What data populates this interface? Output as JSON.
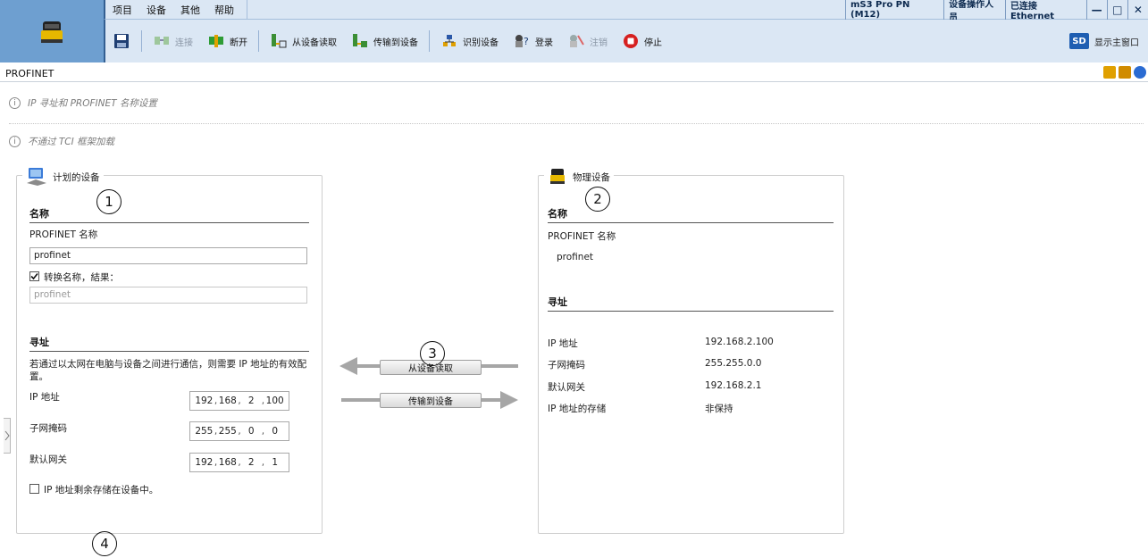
{
  "menu": {
    "items": [
      "项目",
      "设备",
      "其他",
      "帮助"
    ]
  },
  "status": {
    "device": "mS3 Pro PN (M12)",
    "user": "设备操作人员",
    "connection": "已连接 Ethernet"
  },
  "window_buttons": {
    "minimize": "—",
    "maximize": "□",
    "close": "✕"
  },
  "toolbar": {
    "connect": "连接",
    "disconnect": "断开",
    "read_from_device": "从设备读取",
    "transfer_to_device": "传输到设备",
    "identify_device": "识别设备",
    "login": "登录",
    "logout": "注销",
    "stop": "停止",
    "show_main": "显示主窗口",
    "show_main_badge": "SD"
  },
  "page": {
    "title": "PROFINET",
    "info1": "IP 寻址和 PROFINET 名称设置",
    "info2": "不通过 TCI 框架加载",
    "info_icon": "i"
  },
  "planned": {
    "legend": "计划的设备",
    "name_head": "名称",
    "profinet_label": "PROFINET 名称",
    "profinet_value": "profinet",
    "convert_label": "转换名称，結果：",
    "convert_checked": true,
    "convert_result": "profinet",
    "addr_head": "寻址",
    "addr_desc": "若通过以太网在电脑与设备之间进行通信，则需要 IP 地址的有效配置。",
    "ip_label": "IP 地址",
    "ip": [
      "192",
      "168",
      "2",
      "100"
    ],
    "subnet_label": "子网掩码",
    "subnet": [
      "255",
      "255",
      "0",
      "0"
    ],
    "gateway_label": "默认网关",
    "gateway": [
      "192",
      "168",
      "2",
      "1"
    ],
    "persist_label": "IP 地址剩余存储在设备中。",
    "persist_checked": false
  },
  "physical": {
    "legend": "物理设备",
    "name_head": "名称",
    "profinet_label": "PROFINET 名称",
    "profinet_value": "profinet",
    "addr_head": "寻址",
    "rows": [
      {
        "label": "IP 地址",
        "value": "192.168.2.100"
      },
      {
        "label": "子网掩码",
        "value": "255.255.0.0"
      },
      {
        "label": "默认网关",
        "value": "192.168.2.1"
      },
      {
        "label": "IP 地址的存储",
        "value": "非保持"
      }
    ]
  },
  "transfer": {
    "read_btn": "从设备读取",
    "write_btn": "传输到设备"
  },
  "markers": [
    "1",
    "2",
    "3",
    "4"
  ],
  "colors": {
    "toolbar_bg": "#dbe7f4",
    "frame_blue": "#6e9fd0",
    "arrow_gray": "#a6a6a6"
  }
}
